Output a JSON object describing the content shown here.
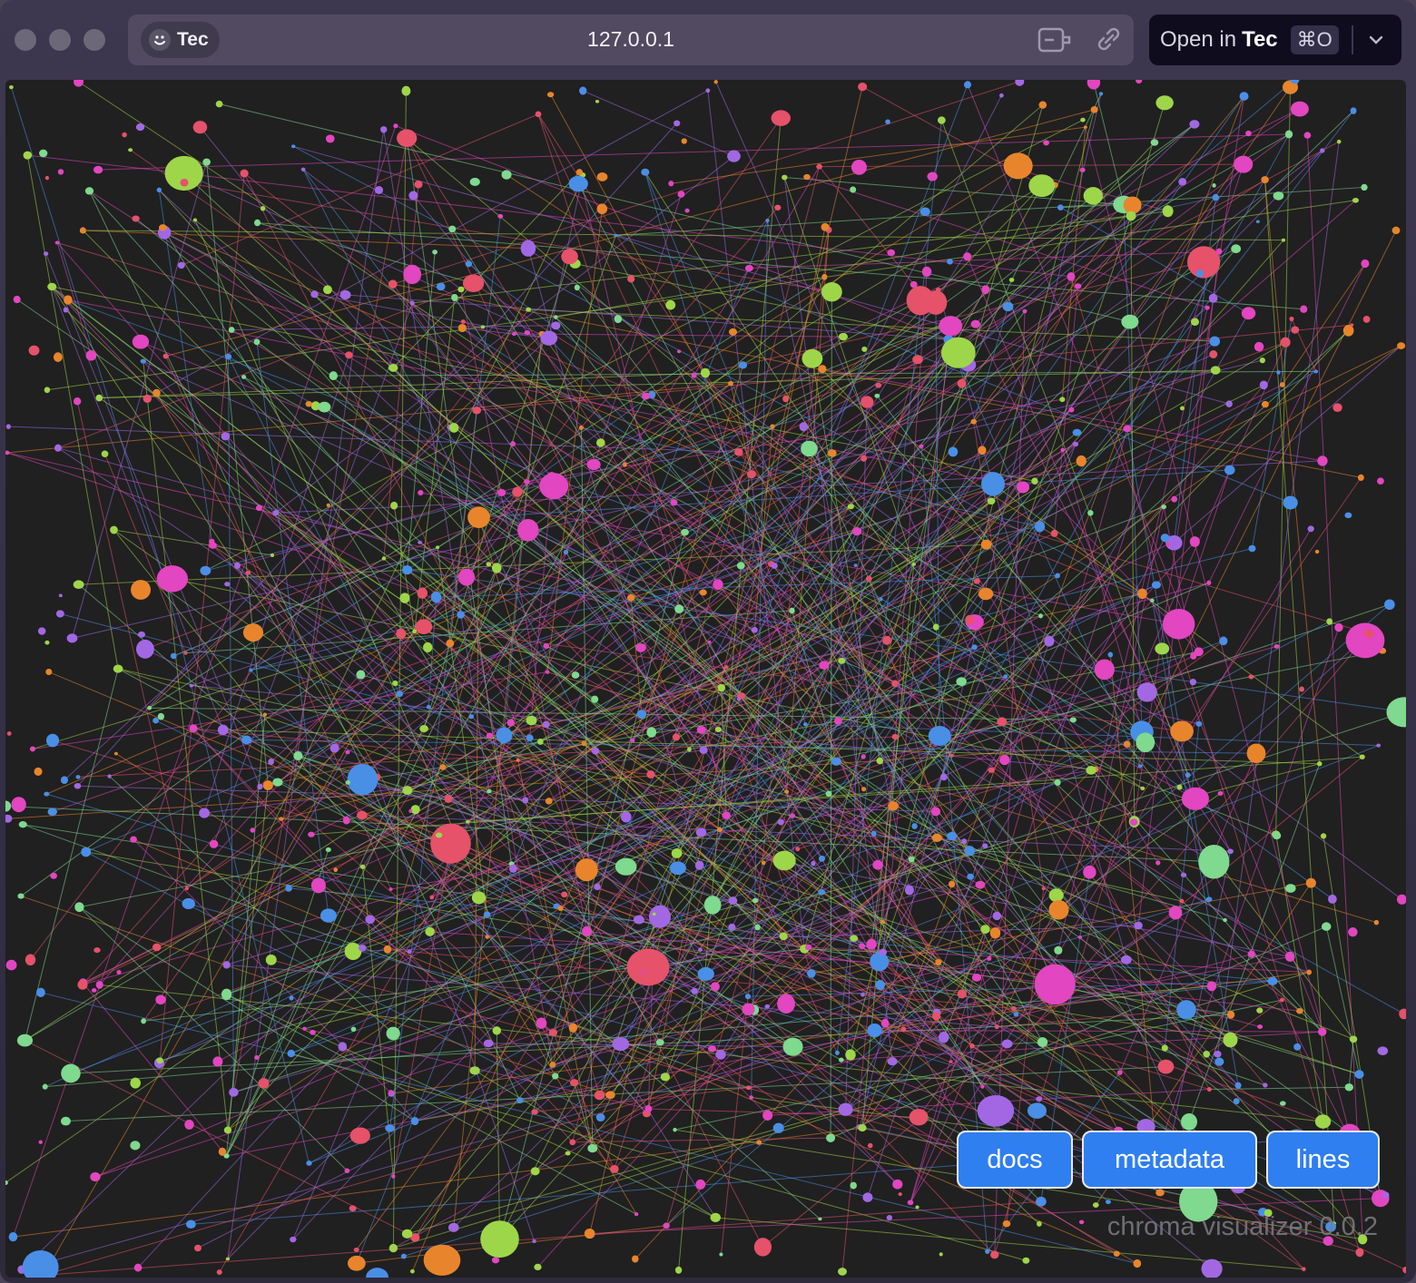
{
  "browser": {
    "tab_label": "Tec",
    "url": "127.0.0.1",
    "open_in_label": "Open in",
    "open_in_app": "Tec",
    "shortcut": "⌘O",
    "icons": [
      "smile-icon",
      "tab-switch-icon",
      "link-icon",
      "chevron-down-icon"
    ]
  },
  "app": {
    "buttons": {
      "docs": "docs",
      "metadata": "metadata",
      "lines": "lines"
    },
    "version": "chroma visualizer 0.0.2"
  },
  "palette": {
    "background": "#202020",
    "button": "#2f7ff0",
    "point_colors": [
      "#e246c0",
      "#9ed64a",
      "#a268e4",
      "#e5526a",
      "#7fd98e",
      "#e8852c",
      "#4a8fe6"
    ]
  }
}
